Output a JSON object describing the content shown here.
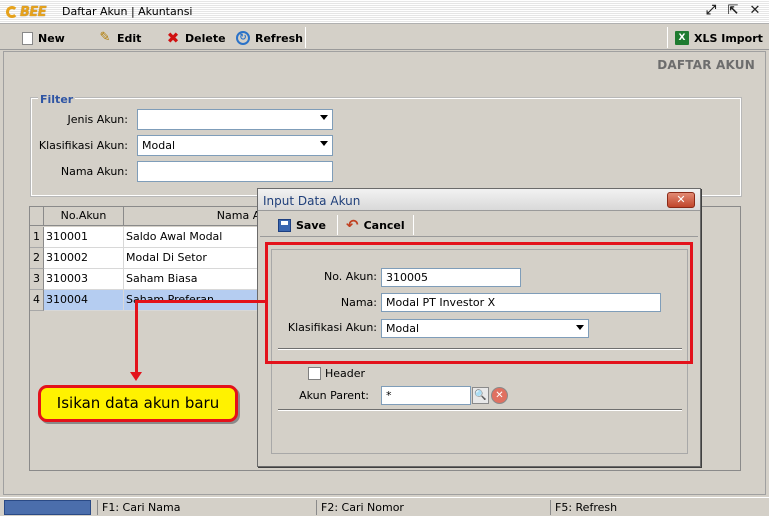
{
  "window": {
    "logo_text": "BEE",
    "title": "Daftar Akun | Akuntansi"
  },
  "toolbar": {
    "new_label": "New",
    "edit_label": "Edit",
    "delete_label": "Delete",
    "refresh_label": "Refresh",
    "import_label": "XLS Import"
  },
  "page": {
    "heading": "DAFTAR AKUN"
  },
  "filter": {
    "legend": "Filter",
    "jenis_label": "Jenis Akun:",
    "jenis_value": "",
    "klasifikasi_label": "Klasifikasi Akun:",
    "klasifikasi_value": "Modal",
    "nama_label": "Nama Akun:",
    "nama_value": ""
  },
  "grid": {
    "columns": [
      "No.Akun",
      "Nama A"
    ],
    "rows": [
      {
        "num": "1",
        "no": "310001",
        "nama": "Saldo Awal Modal"
      },
      {
        "num": "2",
        "no": "310002",
        "nama": "Modal Di Setor"
      },
      {
        "num": "3",
        "no": "310003",
        "nama": "Saham Biasa"
      },
      {
        "num": "4",
        "no": "310004",
        "nama": "Saham Preferan"
      }
    ]
  },
  "dialog": {
    "title": "Input Data Akun",
    "save_label": "Save",
    "cancel_label": "Cancel",
    "no_akun_label": "No. Akun:",
    "no_akun_value": "310005",
    "nama_label": "Nama:",
    "nama_value": "Modal PT Investor X",
    "klasifikasi_label": "Klasifikasi Akun:",
    "klasifikasi_value": "Modal",
    "header_label": "Header",
    "parent_label": "Akun Parent:",
    "parent_value": "*"
  },
  "statusbar": {
    "f1": "F1: Cari Nama",
    "f2": "F2: Cari Nomor",
    "f5": "F5: Refresh"
  },
  "annotation": {
    "callout_text": "Isikan data akun baru"
  },
  "colors": {
    "annotation_red": "#e3121b",
    "callout_yellow": "#fff200",
    "selection_blue": "#b5cdf1",
    "filter_legend_blue": "#2f55a4"
  }
}
